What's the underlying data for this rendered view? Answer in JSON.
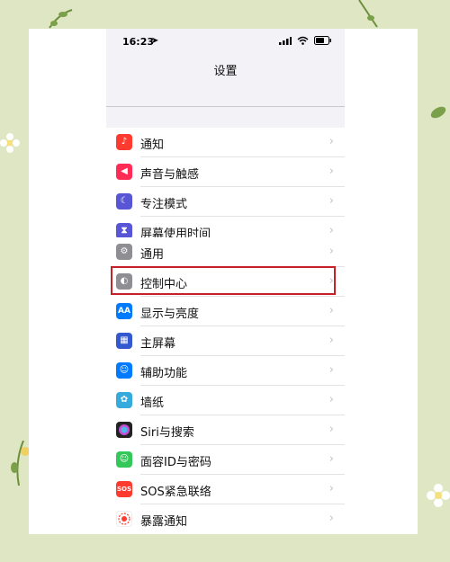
{
  "status_bar": {
    "time": "16:23",
    "location_glyph": "➤"
  },
  "nav": {
    "title": "设置"
  },
  "groups": [
    {
      "items": [
        {
          "label": "通知",
          "icon": "bell-icon",
          "color": "#ff3b30",
          "glyph": "🔔"
        },
        {
          "label": "声音与触感",
          "icon": "speaker-icon",
          "color": "#ff2d55",
          "glyph": "◀"
        },
        {
          "label": "专注模式",
          "icon": "moon-icon",
          "color": "#5856d6",
          "glyph": "☾"
        },
        {
          "label": "屏幕使用时间",
          "icon": "hourglass-icon",
          "color": "#5856d6",
          "glyph": "⧗"
        }
      ]
    },
    {
      "items": [
        {
          "label": "通用",
          "icon": "gear-icon",
          "color": "#8e8e93",
          "glyph": "⚙"
        },
        {
          "label": "控制中心",
          "icon": "toggles-icon",
          "color": "#8e8e93",
          "glyph": "◐"
        },
        {
          "label": "显示与亮度",
          "icon": "text-size-icon",
          "color": "#007aff",
          "glyph": "AA"
        },
        {
          "label": "主屏幕",
          "icon": "grid-icon",
          "color": "#3358d0",
          "glyph": "▦"
        },
        {
          "label": "辅助功能",
          "icon": "accessibility-icon",
          "color": "#007aff",
          "glyph": "♿"
        },
        {
          "label": "墙纸",
          "icon": "flower-icon",
          "color": "#35aadc",
          "glyph": "✿"
        },
        {
          "label": "Siri与搜索",
          "icon": "siri-icon",
          "color": "#222222",
          "glyph": "●"
        },
        {
          "label": "面容ID与密码",
          "icon": "faceid-icon",
          "color": "#34c759",
          "glyph": "☺"
        },
        {
          "label": "SOS紧急联络",
          "icon": "sos-icon",
          "color": "#ff3b30",
          "glyph": "SOS"
        },
        {
          "label": "暴露通知",
          "icon": "exposure-icon",
          "color": "#ffffff",
          "glyph": "✺"
        }
      ]
    }
  ],
  "highlighted_item": "控制中心",
  "chevron": "›"
}
